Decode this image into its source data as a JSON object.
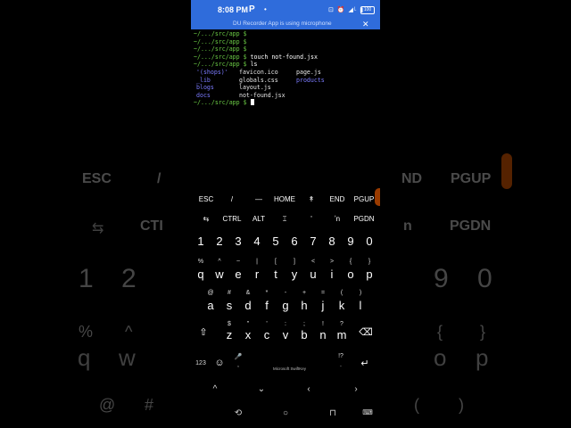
{
  "background": {
    "row1": [
      "ESC",
      "/",
      "ND",
      "PGUP"
    ],
    "row2": [
      "CTI",
      "n",
      "PGDN"
    ],
    "row3": [
      "1",
      "2",
      "9",
      "0"
    ],
    "row4": [
      "%",
      "^",
      "{",
      "}"
    ],
    "row5": [
      "q",
      "w",
      "o",
      "p"
    ],
    "row6": [
      "@",
      "#",
      "(",
      ")"
    ]
  },
  "status_bar": {
    "time": "8:08 PM",
    "app_letter": "P",
    "dot": "•",
    "icons": "⊡ ⏰ ◢ᴸ ▮",
    "battery": "100"
  },
  "notification": {
    "text": "DU Recorder App is using microphone",
    "close": "✕"
  },
  "terminal": {
    "prompt": "~/.../src/app $",
    "lines": [
      {
        "prompt": "~/.../src/app $",
        "cmd": ""
      },
      {
        "prompt": "~/.../src/app $",
        "cmd": ""
      },
      {
        "prompt": "~/.../src/app $",
        "cmd": ""
      },
      {
        "prompt": "~/.../src/app $",
        "cmd": " touch not-found.jsx"
      },
      {
        "prompt": "~/.../src/app $",
        "cmd": " ls"
      }
    ],
    "ls_rows": [
      [
        {
          "t": "'(shops)'",
          "k": "dir"
        },
        {
          "t": "favicon.ico",
          "k": "file"
        },
        {
          "t": "page.js",
          "k": "file"
        }
      ],
      [
        {
          "t": "_lib",
          "k": "dir"
        },
        {
          "t": "globals.css",
          "k": "file"
        },
        {
          "t": "products",
          "k": "dir"
        }
      ],
      [
        {
          "t": "blogs",
          "k": "dir"
        },
        {
          "t": "layout.js",
          "k": "file"
        },
        {
          "t": "",
          "k": "file"
        }
      ],
      [
        {
          "t": "docs",
          "k": "dir"
        },
        {
          "t": "not-found.jsx",
          "k": "file"
        },
        {
          "t": "",
          "k": "file"
        }
      ]
    ],
    "last_prompt": "~/.../src/app $"
  },
  "extra_keys": {
    "row1": [
      "ESC",
      "/",
      "—",
      "HOME",
      "↟",
      "END",
      "PGUP"
    ],
    "row2": [
      "⇆",
      "CTRL",
      "ALT",
      "⌶",
      "'",
      "ʼn",
      "PGDN"
    ]
  },
  "keyboard": {
    "numbers": [
      "1",
      "2",
      "3",
      "4",
      "5",
      "6",
      "7",
      "8",
      "9",
      "0"
    ],
    "sym1": [
      "%",
      "^",
      "~",
      "|",
      "[",
      "]",
      "<",
      ">",
      "{",
      "}"
    ],
    "row1": [
      "q",
      "w",
      "e",
      "r",
      "t",
      "y",
      "u",
      "i",
      "o",
      "p"
    ],
    "sym2": [
      "@",
      "#",
      "&",
      "*",
      "-",
      "+",
      "=",
      "(",
      ")"
    ],
    "row2": [
      "a",
      "s",
      "d",
      "f",
      "g",
      "h",
      "j",
      "k",
      "l"
    ],
    "sym3": [
      "$",
      "\"",
      "'",
      ":",
      ";",
      "!",
      "?"
    ],
    "row3": [
      "z",
      "x",
      "c",
      "v",
      "b",
      "n",
      "m"
    ],
    "shift": "⇧",
    "backspace": "⌫",
    "num_toggle": "123",
    "emoji": "☺",
    "mic": "🎤",
    "comma": ",",
    "brand": "Microsoft SwiftKey",
    "period": ".",
    "qmark": "!?",
    "enter": "↵",
    "nav": [
      "^",
      "⌄",
      "‹",
      "›"
    ],
    "system": [
      "⟲",
      "○",
      "⊓",
      "⌨"
    ]
  }
}
